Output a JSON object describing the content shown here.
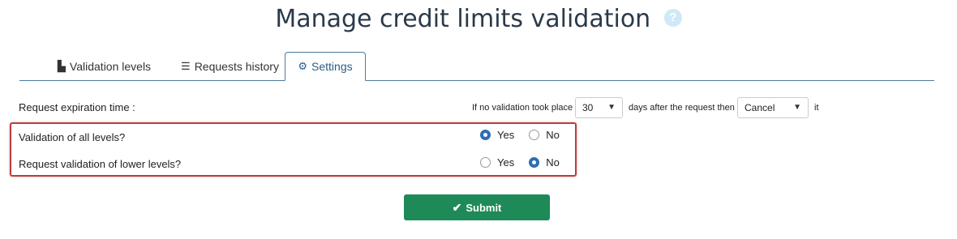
{
  "page": {
    "title": "Manage credit limits validation",
    "help_glyph": "?"
  },
  "tabs": [
    {
      "label": "Validation levels",
      "icon": "bar-chart-icon",
      "glyph": "▙",
      "active": false
    },
    {
      "label": "Requests history",
      "icon": "list-icon",
      "glyph": "☰",
      "active": false
    },
    {
      "label": "Settings",
      "icon": "gear-icon",
      "glyph": "⚙",
      "active": true
    }
  ],
  "settings": {
    "expiration": {
      "label": "Request expiration time :",
      "prefix": "If no validation took place",
      "days_value": "30",
      "middle": "days after the request then",
      "action_value": "Cancel",
      "suffix": "it"
    },
    "validation_all_levels": {
      "label": "Validation of all levels?",
      "yes_label": "Yes",
      "no_label": "No",
      "selected": "Yes"
    },
    "request_lower_levels": {
      "label": "Request validation of lower levels?",
      "yes_label": "Yes",
      "no_label": "No",
      "selected": "No"
    }
  },
  "submit": {
    "label": "Submit"
  },
  "colors": {
    "accent": "#2f6db3",
    "submit": "#1e8a57",
    "highlight_border": "#c23b3b",
    "tab_border": "#4a7aa3"
  }
}
